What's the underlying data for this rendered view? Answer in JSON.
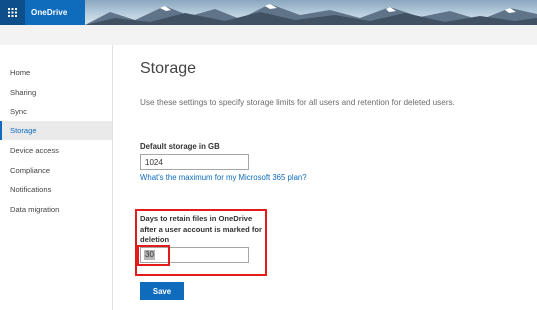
{
  "header": {
    "app_name": "OneDrive",
    "waffle_icon": "waffle-grid-icon"
  },
  "nav": {
    "items": [
      {
        "label": "Home"
      },
      {
        "label": "Sharing"
      },
      {
        "label": "Sync"
      },
      {
        "label": "Storage",
        "selected": true
      },
      {
        "label": "Device access"
      },
      {
        "label": "Compliance"
      },
      {
        "label": "Notifications"
      },
      {
        "label": "Data migration"
      }
    ]
  },
  "main": {
    "title": "Storage",
    "subtitle": "Use these settings to specify storage limits for all users and retention for deleted users.",
    "default_storage": {
      "label": "Default storage in GB",
      "value": "1024",
      "link": "What's the maximum for my Microsoft 365 plan?"
    },
    "retention": {
      "label": "Days to retain files in OneDrive after a user account is marked for deletion",
      "value": "30"
    },
    "save_label": "Save"
  },
  "colors": {
    "accent": "#0f6cbd",
    "highlight_box": "#e21b1b",
    "waffle_bg": "#0e4f8a"
  }
}
